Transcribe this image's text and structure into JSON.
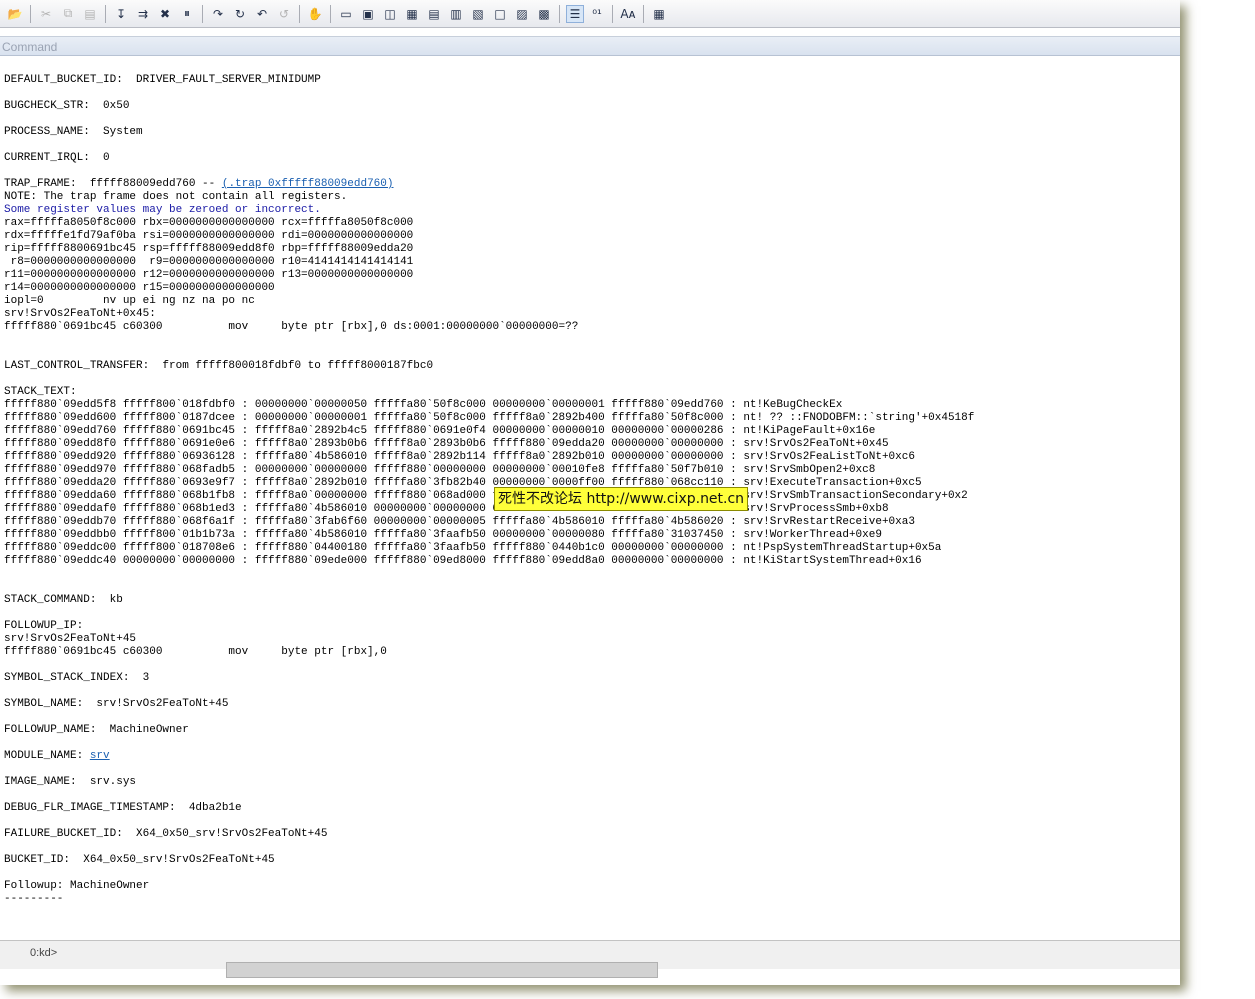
{
  "window": {
    "title": "Command",
    "status": "0:kd>"
  },
  "toolbar": {
    "buttons": [
      {
        "name": "open-icon",
        "glyph": "📂"
      },
      {
        "sep": true
      },
      {
        "name": "cut-icon",
        "glyph": "✂",
        "disabled": true
      },
      {
        "name": "copy-icon",
        "glyph": "⧉",
        "disabled": true
      },
      {
        "name": "paste-icon",
        "glyph": "▤",
        "disabled": true
      },
      {
        "sep": true
      },
      {
        "name": "go-icon",
        "glyph": "↧"
      },
      {
        "name": "restart-icon",
        "glyph": "⇉"
      },
      {
        "name": "stop-debugging-icon",
        "glyph": "✖"
      },
      {
        "name": "break-icon",
        "glyph": "⏸"
      },
      {
        "sep": true
      },
      {
        "name": "step-into-icon",
        "glyph": "↷"
      },
      {
        "name": "step-over-icon",
        "glyph": "↻"
      },
      {
        "name": "step-out-icon",
        "glyph": "↶"
      },
      {
        "name": "run-to-cursor-icon",
        "glyph": "↺",
        "disabled": true
      },
      {
        "sep": true
      },
      {
        "name": "hand-icon",
        "glyph": "✋"
      },
      {
        "sep": true
      },
      {
        "name": "command-window-icon",
        "glyph": "▭"
      },
      {
        "name": "watch-window-icon",
        "glyph": "▣"
      },
      {
        "name": "locals-window-icon",
        "glyph": "◫"
      },
      {
        "name": "registers-window-icon",
        "glyph": "▦"
      },
      {
        "name": "memory-window-icon",
        "glyph": "▤"
      },
      {
        "name": "call-stack-window-icon",
        "glyph": "▥"
      },
      {
        "name": "disassembly-window-icon",
        "glyph": "▧"
      },
      {
        "name": "scratch-pad-icon",
        "glyph": "□"
      },
      {
        "name": "processes-threads-icon",
        "glyph": "▨"
      },
      {
        "name": "source-mode-icon",
        "glyph": "▩"
      },
      {
        "sep": true
      },
      {
        "name": "source-mode-on-icon",
        "glyph": "☰",
        "active": true
      },
      {
        "name": "hex-mode-icon",
        "glyph": "⁰¹"
      },
      {
        "sep": true
      },
      {
        "name": "font-icon",
        "glyph": "Aᴀ"
      },
      {
        "sep": true
      },
      {
        "name": "options-icon",
        "glyph": "▦"
      }
    ]
  },
  "output": {
    "lines": [
      {
        "t": ""
      },
      {
        "t": "DEFAULT_BUCKET_ID:  DRIVER_FAULT_SERVER_MINIDUMP"
      },
      {
        "t": ""
      },
      {
        "t": "BUGCHECK_STR:  0x50"
      },
      {
        "t": ""
      },
      {
        "t": "PROCESS_NAME:  System"
      },
      {
        "t": ""
      },
      {
        "t": "CURRENT_IRQL:  0"
      },
      {
        "t": ""
      },
      {
        "t": "TRAP_FRAME:  fffff88009edd760 -- ",
        "link": "(.trap 0xfffff88009edd760)"
      },
      {
        "t": "NOTE: The trap frame does not contain all registers."
      },
      {
        "t": "Some register values may be zeroed or incorrect.",
        "blue": true
      },
      {
        "t": "rax=fffffa8050f8c000 rbx=0000000000000000 rcx=fffffa8050f8c000"
      },
      {
        "t": "rdx=fffffe1fd79af0ba rsi=0000000000000000 rdi=0000000000000000"
      },
      {
        "t": "rip=fffff8800691bc45 rsp=fffff88009edd8f0 rbp=fffff88009edda20"
      },
      {
        "t": " r8=0000000000000000  r9=0000000000000000 r10=4141414141414141"
      },
      {
        "t": "r11=0000000000000000 r12=0000000000000000 r13=0000000000000000"
      },
      {
        "t": "r14=0000000000000000 r15=0000000000000000"
      },
      {
        "t": "iopl=0         nv up ei ng nz na po nc"
      },
      {
        "t": "srv!SrvOs2FeaToNt+0x45:"
      },
      {
        "t": "fffff880`0691bc45 c60300          mov     byte ptr [rbx],0 ds:0001:00000000`00000000=??"
      },
      {
        "t": ""
      },
      {
        "t": ""
      },
      {
        "t": "LAST_CONTROL_TRANSFER:  from fffff800018fdbf0 to fffff8000187fbc0"
      },
      {
        "t": ""
      },
      {
        "t": "STACK_TEXT:"
      },
      {
        "t": "fffff880`09edd5f8 fffff800`018fdbf0 : 00000000`00000050 fffffa80`50f8c000 00000000`00000001 fffff880`09edd760 : nt!KeBugCheckEx"
      },
      {
        "t": "fffff880`09edd600 fffff800`0187dcee : 00000000`00000001 fffffa80`50f8c000 fffff8a0`2892b400 fffffa80`50f8c000 : nt! ?? ::FNODOBFM::`string'+0x4518f"
      },
      {
        "t": "fffff880`09edd760 fffff880`0691bc45 : fffff8a0`2892b4c5 fffff880`0691e0f4 00000000`00000010 00000000`00000286 : nt!KiPageFault+0x16e"
      },
      {
        "t": "fffff880`09edd8f0 fffff880`0691e0e6 : fffff8a0`2893b0b6 fffff8a0`2893b0b6 fffff880`09edda20 00000000`00000000 : srv!SrvOs2FeaToNt+0x45"
      },
      {
        "t": "fffff880`09edd920 fffff880`06936128 : fffffa80`4b586010 fffff8a0`2892b114 fffff8a0`2892b010 00000000`00000000 : srv!SrvOs2FeaListToNt+0xc6"
      },
      {
        "t": "fffff880`09edd970 fffff880`068fadb5 : 00000000`00000000 fffff880`00000000 00000000`00010fe8 fffffa80`50f7b010 : srv!SrvSmbOpen2+0xc8"
      },
      {
        "t": "fffff880`09edda20 fffff880`0693e9f7 : fffff8a0`2892b010 fffffa80`3fb82b40 00000000`0000ff00 fffff880`068cc110 : srv!ExecuteTransaction+0xc5"
      },
      {
        "t": "fffff880`09edda60 fffff880`068b1fb8 : fffff8a0`00000000 fffff880`068ad000 fffff880`068a2e00 00000000`0000f7d0 : srv!SrvSmbTransactionSecondary+0x2"
      },
      {
        "t": "fffff880`09eddaf0 fffff880`068b1ed3 : fffffa80`4b586010 00000000`00000000 00000000`00000000 fffffa80`4b586010 : srv!SrvProcessSmb+0xb8"
      },
      {
        "t": "fffff880`09eddb70 fffff880`068f6a1f : fffffa80`3fab6f60 00000000`00000005 fffffa80`4b586010 fffffa80`4b586020 : srv!SrvRestartReceive+0xa3"
      },
      {
        "t": "fffff880`09eddbb0 fffff800`01b1b73a : fffffa80`4b586010 fffffa80`3faafb50 00000000`00000080 fffffa80`31037450 : srv!WorkerThread+0xe9"
      },
      {
        "t": "fffff880`09eddc00 fffff800`018708e6 : fffff880`04400180 fffffa80`3faafb50 fffff880`0440b1c0 00000000`00000000 : nt!PspSystemThreadStartup+0x5a"
      },
      {
        "t": "fffff880`09eddc40 00000000`00000000 : fffff880`09ede000 fffff880`09ed8000 fffff880`09edd8a0 00000000`00000000 : nt!KiStartSystemThread+0x16"
      },
      {
        "t": ""
      },
      {
        "t": ""
      },
      {
        "t": "STACK_COMMAND:  kb"
      },
      {
        "t": ""
      },
      {
        "t": "FOLLOWUP_IP:"
      },
      {
        "t": "srv!SrvOs2FeaToNt+45"
      },
      {
        "t": "fffff880`0691bc45 c60300          mov     byte ptr [rbx],0"
      },
      {
        "t": ""
      },
      {
        "t": "SYMBOL_STACK_INDEX:  3"
      },
      {
        "t": ""
      },
      {
        "t": "SYMBOL_NAME:  srv!SrvOs2FeaToNt+45"
      },
      {
        "t": ""
      },
      {
        "t": "FOLLOWUP_NAME:  MachineOwner"
      },
      {
        "t": ""
      },
      {
        "t": "MODULE_NAME: ",
        "link": "srv"
      },
      {
        "t": ""
      },
      {
        "t": "IMAGE_NAME:  srv.sys"
      },
      {
        "t": ""
      },
      {
        "t": "DEBUG_FLR_IMAGE_TIMESTAMP:  4dba2b1e"
      },
      {
        "t": ""
      },
      {
        "t": "FAILURE_BUCKET_ID:  X64_0x50_srv!SrvOs2FeaToNt+45"
      },
      {
        "t": ""
      },
      {
        "t": "BUCKET_ID:  X64_0x50_srv!SrvOs2FeaToNt+45"
      },
      {
        "t": ""
      },
      {
        "t": "Followup: MachineOwner"
      },
      {
        "t": "---------"
      }
    ]
  },
  "watermark": {
    "text": "死性不改论坛 http://www.cixp.net.cn"
  },
  "colors": {
    "link": "#1a5fb0",
    "note_blue": "#1a1aa6",
    "watermark_bg": "#ffff3a"
  }
}
